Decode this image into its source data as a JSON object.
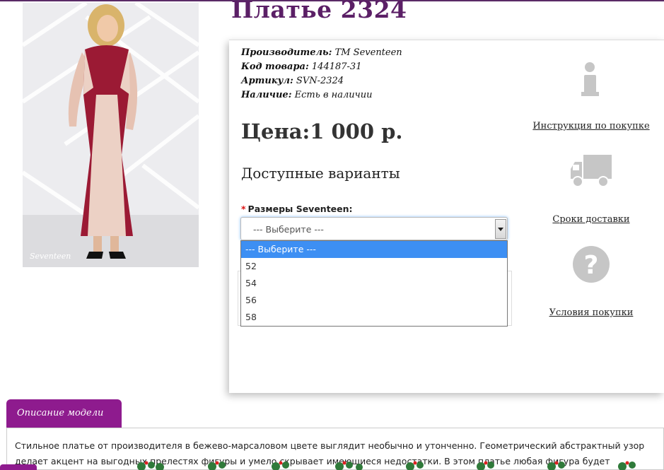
{
  "product": {
    "title": "Платье 2324",
    "meta": [
      {
        "label": "Производитель:",
        "value": "ТМ Seventeen"
      },
      {
        "label": "Код товара:",
        "value": "144187-31"
      },
      {
        "label": "Артикул:",
        "value": "SVN-2324"
      },
      {
        "label": "Наличие:",
        "value": "Есть в наличии"
      }
    ],
    "price": "Цена:1 000 р.",
    "variants_heading": "Доступные варианты",
    "size_label": "Размеры Seventeen:",
    "required_mark": "*",
    "photo_watermark": "Seventeen"
  },
  "size_select": {
    "value": "--- Выберите ---",
    "options": [
      "--- Выберите ---",
      "52",
      "54",
      "56",
      "58"
    ]
  },
  "side_links": {
    "instruction": "Инструкция по покупке",
    "delivery": "Сроки доставки",
    "conditions": "Условия покупки"
  },
  "description": {
    "tab_label": "Описание модели",
    "text": "Стильное платье от производителя в бежево-марсаловом цвете выглядит необычно и утонченно. Геометрический абстрактный узор делает акцент на выгодных прелестях фигуры и умело скрывает имеющиеся недостатки. В этом платье любая фигура будет выглядеть"
  },
  "colors": {
    "title": "#5b1f66",
    "tab": "#8e1b8e",
    "selected_option": "#3d8ff3"
  }
}
